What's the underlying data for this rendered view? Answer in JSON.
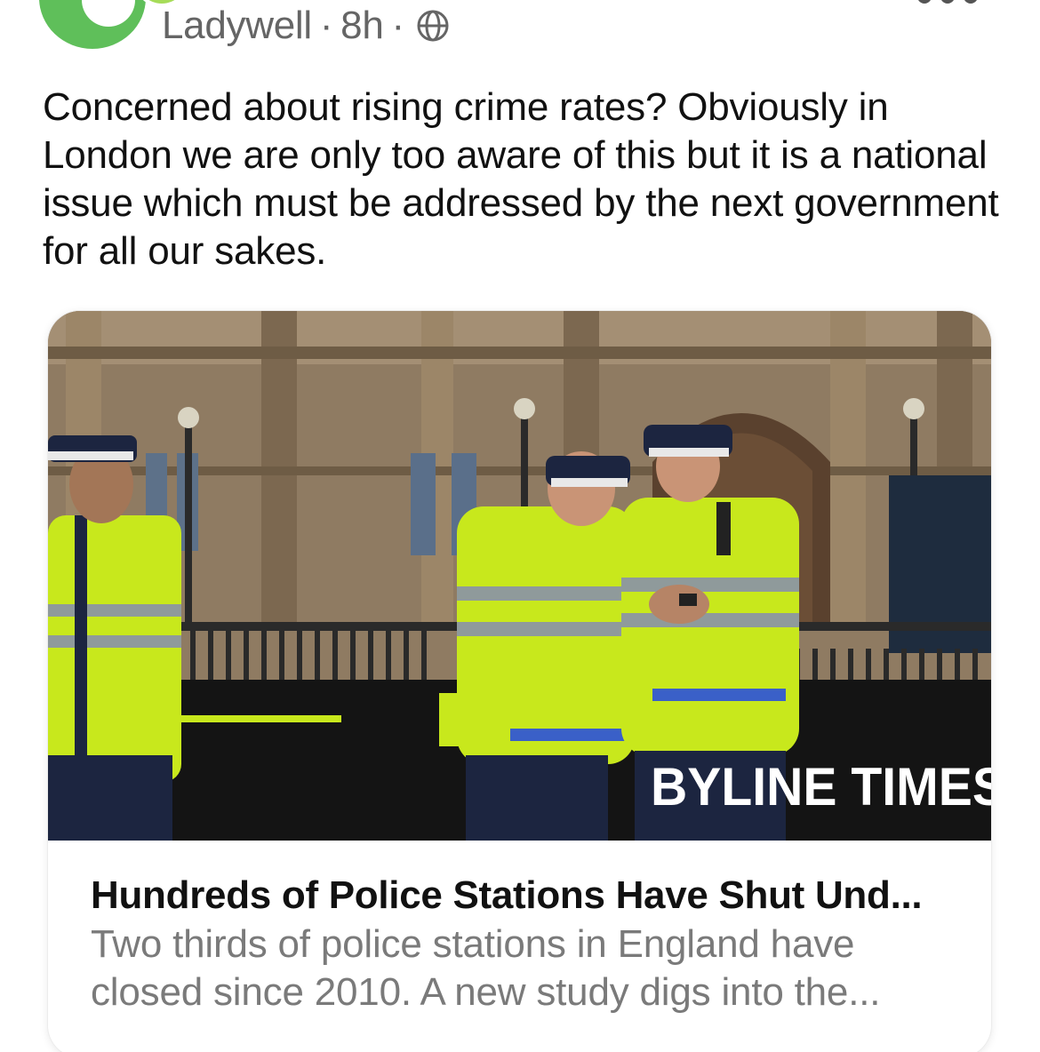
{
  "header": {
    "group_name": "Ladywell",
    "separator_1": "·",
    "time": "8h",
    "separator_2": "·",
    "visibility_icon": "globe-icon",
    "group_icon": "coffee-cup-icon",
    "more_icon": "more-options-icon"
  },
  "post": {
    "text": "Concerned about rising crime rates? Obviously in London we are only too aware of this but it is a national issue which must be addressed by the next government for all our sakes."
  },
  "link_card": {
    "image_watermark": "BYLINE TIMES",
    "title": "Hundreds of Police Stations Have Shut Und...",
    "description": "Two thirds of police stations in England have closed since 2010. A new study digs into the..."
  },
  "colors": {
    "avatar_green": "#5fbf5a",
    "badge_green": "#a6dc58",
    "meta_gray": "#656565",
    "text_dark": "#111111",
    "desc_gray": "#7a7a7a",
    "hi_vis_yellow": "#c8e81c",
    "police_navy": "#1c2540"
  }
}
